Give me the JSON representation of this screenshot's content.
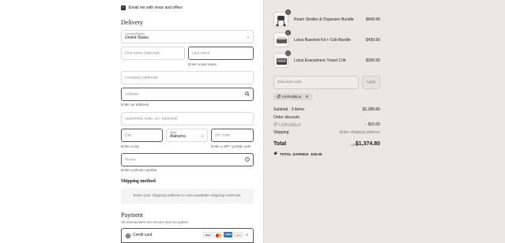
{
  "contact": {
    "newsletter_label": "Email me with news and offers",
    "newsletter_checked": true
  },
  "delivery": {
    "title": "Delivery",
    "country_label": "Country/Region",
    "country_value": "United States",
    "first_name_placeholder": "First name (optional)",
    "last_name_placeholder": "Last name",
    "last_name_error": "Enter a last name",
    "company_placeholder": "Company (optional)",
    "address_placeholder": "Address",
    "address_error": "Enter an address",
    "apartment_placeholder": "Apartment, suite, etc. (optional)",
    "city_placeholder": "City",
    "city_error": "Enter a city",
    "state_label": "State",
    "state_value": "Alabama",
    "zip_placeholder": "ZIP code",
    "zip_error": "Enter a ZIP / postal code",
    "phone_placeholder": "Phone",
    "phone_error": "Enter a phone number"
  },
  "shipping": {
    "title": "Shipping method",
    "message": "Enter your shipping address to view available shipping methods."
  },
  "payment": {
    "title": "Payment",
    "subtitle": "All transactions are secure and encrypted.",
    "method_label": "Credit card",
    "card_brands": [
      "VISA",
      "MC",
      "AMEX",
      "DISC"
    ],
    "more_label": "+5"
  },
  "order": {
    "items": [
      {
        "name": "Roam Stroller & Organizer Bundle",
        "price": "$649.95",
        "qty": "1"
      },
      {
        "name": "Lotus Bassinet Kit + Crib Bundle",
        "price": "$439.90",
        "qty": "1"
      },
      {
        "name": "Lotus Everywhere Travel Crib",
        "price": "$299.95",
        "qty": "1"
      }
    ],
    "discount_placeholder": "Discount code",
    "apply_label": "Apply",
    "applied_code": "LIVFUSELLI",
    "subtotal_label": "Subtotal · 3 items",
    "subtotal_value": "$1,389.80",
    "order_discount_label": "Order discount",
    "discount_code_label": "LIVFUSELLI",
    "discount_value": "− $15.00",
    "shipping_label": "Shipping",
    "shipping_value": "Enter shipping address",
    "total_label": "Total",
    "currency": "USD",
    "total_value": "$1,374.80",
    "savings_label": "TOTAL SAVINGS",
    "savings_value": "$15.00"
  },
  "colors": {
    "accent": "#1a1a1a",
    "sidebar_bg": "#ebe7e3",
    "error_border": "#5a5a5a"
  }
}
